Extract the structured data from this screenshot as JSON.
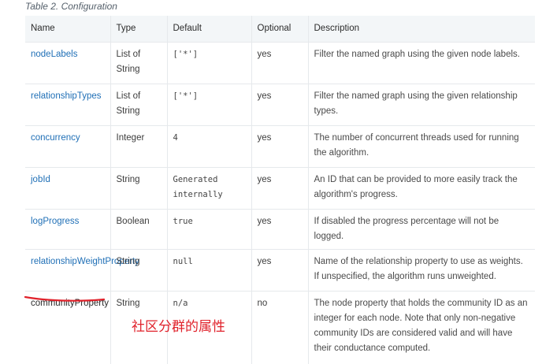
{
  "table": {
    "caption": "Table 2. Configuration",
    "headers": [
      "Name",
      "Type",
      "Default",
      "Optional",
      "Description"
    ],
    "rows": [
      {
        "name": "nodeLabels",
        "type": "List of String",
        "default": "['*']",
        "optional": "yes",
        "description": "Filter the named graph using the given node labels."
      },
      {
        "name": "relationshipTypes",
        "type": "List of String",
        "default": "['*']",
        "optional": "yes",
        "description": "Filter the named graph using the given relationship types."
      },
      {
        "name": "concurrency",
        "type": "Integer",
        "default": "4",
        "optional": "yes",
        "description": "The number of concurrent threads used for running the algorithm."
      },
      {
        "name": "jobId",
        "type": "String",
        "default": "Generated internally",
        "optional": "yes",
        "description": "An ID that can be provided to more easily track the algorithm's progress."
      },
      {
        "name": "logProgress",
        "type": "Boolean",
        "default": "true",
        "optional": "yes",
        "description": "If disabled the progress percentage will not be logged."
      },
      {
        "name": "relationshipWeightProperty",
        "type": "String",
        "default": "null",
        "optional": "yes",
        "description": "Name of the relationship property to use as weights. If unspecified, the algorithm runs unweighted."
      },
      {
        "name": "communityProperty",
        "type": "String",
        "default": "n/a",
        "optional": "no",
        "description": "The node property that holds the community ID as an integer for each node. Note that only non-negative community IDs are considered valid and will have their conductance computed."
      }
    ]
  },
  "annotation": {
    "text": "社区分群的属性",
    "color": "#e0222b"
  },
  "colors": {
    "link": "#1f6fb6",
    "header_bg": "#f3f6f8",
    "border": "#e6e9ec"
  }
}
